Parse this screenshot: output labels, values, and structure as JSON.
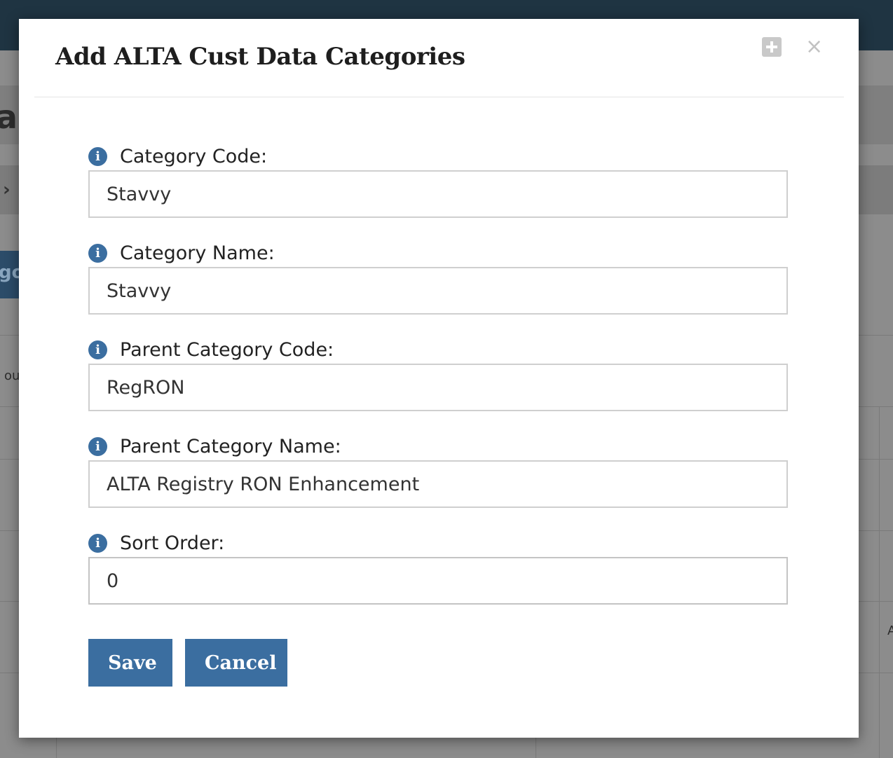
{
  "background": {
    "title_fragment": "a",
    "chip_fragment": "go",
    "row_fragment": "ou",
    "right_fragment": "A"
  },
  "modal": {
    "title": "Add ALTA Cust Data Categories",
    "icons": {
      "expand": "plus-square-icon",
      "close": "close-icon",
      "close_glyph": "×",
      "info_glyph": "i"
    },
    "fields": [
      {
        "label": "Category Code:",
        "value": "Stavvy"
      },
      {
        "label": "Category Name:",
        "value": "Stavvy"
      },
      {
        "label": "Parent Category Code:",
        "value": "RegRON"
      },
      {
        "label": "Parent Category Name:",
        "value": "ALTA Registry RON Enhancement"
      },
      {
        "label": "Sort Order:",
        "value": "0"
      }
    ],
    "buttons": {
      "save": "Save",
      "cancel": "Cancel"
    }
  },
  "colors": {
    "accent": "#3b6ea0",
    "topbar": "#1f3442"
  }
}
